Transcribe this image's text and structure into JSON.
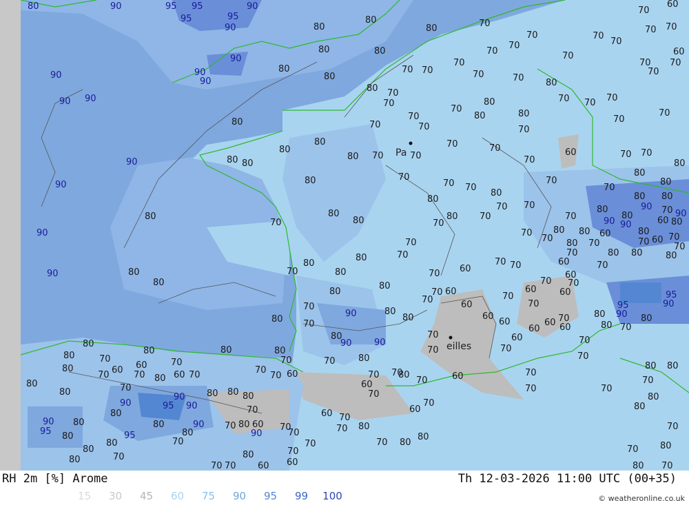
{
  "footer": {
    "title": "RH 2m [%] Arome",
    "datetime": "Th 12-03-2026 11:00 UTC (00+35)",
    "credit": "© weatheronline.co.uk"
  },
  "legend": [
    {
      "label": "15",
      "color": "#d9d9d9"
    },
    {
      "label": "30",
      "color": "#c8c8c8"
    },
    {
      "label": "45",
      "color": "#b5b5b5"
    },
    {
      "label": "60",
      "color": "#a8d4f0"
    },
    {
      "label": "75",
      "color": "#88bfe8"
    },
    {
      "label": "90",
      "color": "#6fa3dd"
    },
    {
      "label": "95",
      "color": "#5487d2"
    },
    {
      "label": "99",
      "color": "#3b66c4"
    },
    {
      "label": "100",
      "color": "#2a48b5"
    }
  ],
  "cities": {
    "paris": "Pa",
    "marseille": "eilles"
  },
  "contours": {
    "c60": "60",
    "c70": "70",
    "c80": "80",
    "c90": "90",
    "c95": "95"
  },
  "colors": {
    "sea_90": "#7fa8de",
    "land_80": "#9cc3ea",
    "land_70": "#a9d4f0",
    "dry_60": "#bdbdbd",
    "wet_95": "#6a8fd8",
    "coast": "#2db92d",
    "contour": "#555555",
    "left_strip": "#c8c8c8"
  }
}
